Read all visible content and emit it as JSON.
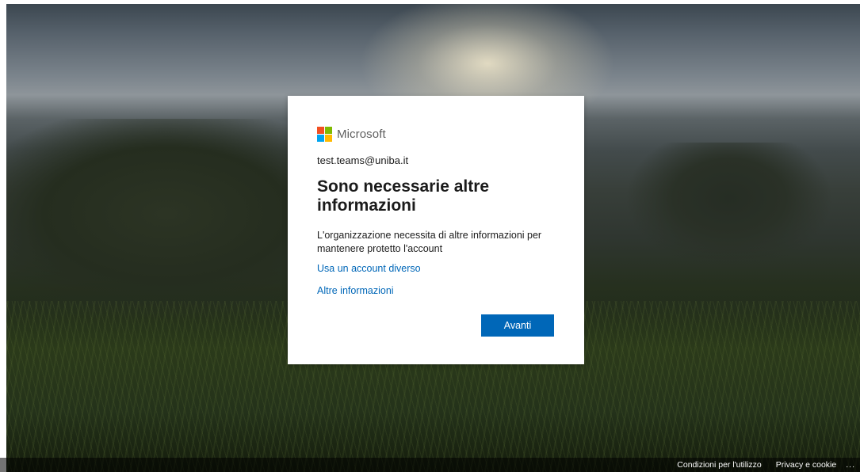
{
  "brand": {
    "logo_text": "Microsoft",
    "logo_colors": [
      "#f25022",
      "#7fba00",
      "#00a4ef",
      "#ffb900"
    ]
  },
  "card": {
    "account_email": "test.teams@uniba.it",
    "title": "Sono necessarie altre informazioni",
    "description": "L'organizzazione necessita di altre informazioni per mantenere protetto l'account",
    "link_other_account": "Usa un account diverso",
    "link_more_info": "Altre informazioni",
    "next_button": "Avanti"
  },
  "footer": {
    "terms": "Condizioni per l'utilizzo",
    "privacy": "Privacy e cookie",
    "more": "..."
  },
  "colors": {
    "accent": "#0067b8",
    "text": "#1b1b1b"
  }
}
